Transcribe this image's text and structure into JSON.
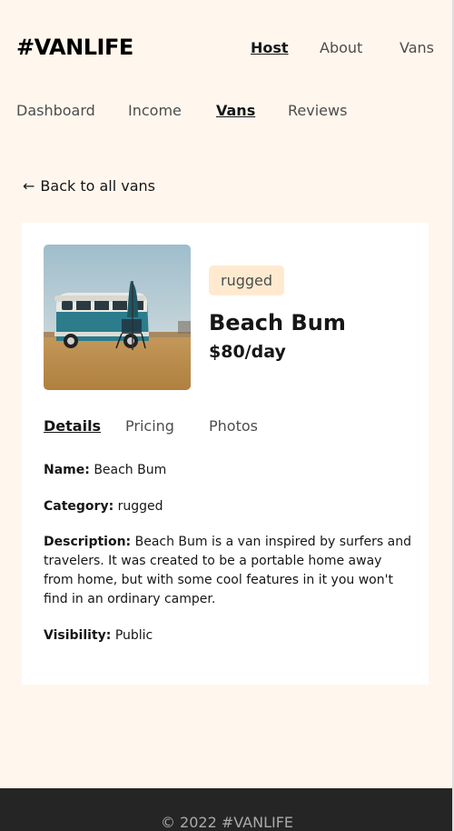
{
  "header": {
    "logo": "#VANLIFE",
    "nav": [
      {
        "label": "Host",
        "active": true
      },
      {
        "label": "About",
        "active": false
      },
      {
        "label": "Vans",
        "active": false
      }
    ]
  },
  "host_nav": [
    {
      "label": "Dashboard",
      "active": false
    },
    {
      "label": "Income",
      "active": false
    },
    {
      "label": "Vans",
      "active": true
    },
    {
      "label": "Reviews",
      "active": false
    }
  ],
  "back_link": {
    "arrow": "←",
    "label": "Back to all vans"
  },
  "van": {
    "type_badge": "rugged",
    "name": "Beach Bum",
    "price": "$80",
    "price_unit": "/day",
    "image_icon": "van-photo"
  },
  "tabs": [
    {
      "label": "Details",
      "active": true
    },
    {
      "label": "Pricing",
      "active": false
    },
    {
      "label": "Photos",
      "active": false
    }
  ],
  "details": {
    "name_label": "Name:",
    "name_value": "Beach Bum",
    "category_label": "Category:",
    "category_value": "rugged",
    "description_label": "Description:",
    "description_value": "Beach Bum is a van inspired by surfers and travelers. It was created to be a portable home away from home, but with some cool features in it you won't find in an ordinary camper.",
    "visibility_label": "Visibility:",
    "visibility_value": "Public"
  },
  "footer": {
    "text": "© 2022 #VANLIFE"
  },
  "colors": {
    "background": "#fff7ed",
    "badge_bg": "#ffead0",
    "footer_bg": "#252525",
    "card_bg": "#ffffff"
  }
}
